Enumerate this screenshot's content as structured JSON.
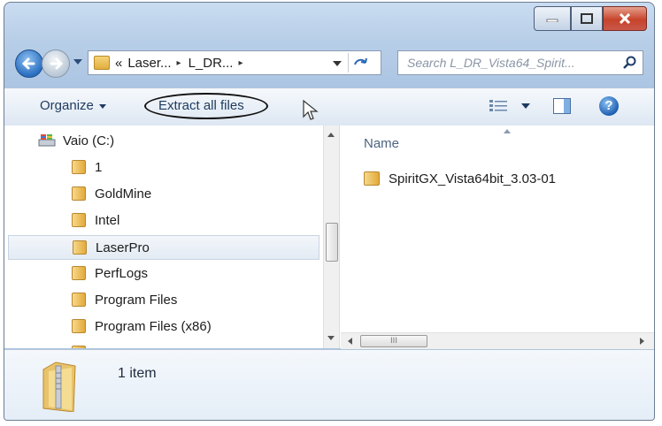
{
  "window": {
    "controls": {
      "minimize_icon": "minimize-icon",
      "maximize_icon": "maximize-icon",
      "close_icon": "close-icon"
    }
  },
  "address_bar": {
    "prefix": "«",
    "segments": [
      "Laser...",
      "L_DR..."
    ],
    "separator": "▸"
  },
  "search": {
    "placeholder": "Search L_DR_Vista64_Spirit..."
  },
  "toolbar": {
    "organize_label": "Organize",
    "extract_label": "Extract all files"
  },
  "nav_pane": {
    "drive_label": "Vaio (C:)",
    "folders": [
      {
        "label": "1"
      },
      {
        "label": "GoldMine"
      },
      {
        "label": "Intel"
      },
      {
        "label": "LaserPro",
        "selected": true
      },
      {
        "label": "PerfLogs"
      },
      {
        "label": "Program Files"
      },
      {
        "label": "Program Files (x86)"
      }
    ]
  },
  "main_pane": {
    "column_name": "Name",
    "files": [
      {
        "label": "SpiritGX_Vista64bit_3.03-01"
      }
    ],
    "hscroll_thumb": "III"
  },
  "details": {
    "item_count": "1 item"
  },
  "colors": {
    "accent": "#2a6fc1",
    "close": "#c7432b"
  }
}
